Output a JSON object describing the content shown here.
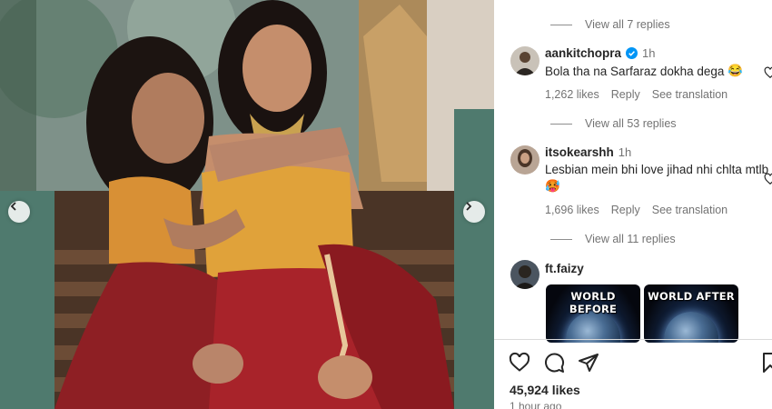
{
  "photo": {
    "alt_subject": "",
    "prev_icon": "chevron-left-icon",
    "next_icon": "chevron-right-icon"
  },
  "replies_top": {
    "label": "View all 7 replies"
  },
  "comments": [
    {
      "user": "aankitchopra",
      "verified": true,
      "time": "1h",
      "text": "Bola tha na Sarfaraz dokha dega",
      "emoji": "😂",
      "likes": "1,262 likes",
      "reply": "Reply",
      "translate": "See translation",
      "replies": "View all 53 replies"
    },
    {
      "user": "itsokearshh",
      "verified": false,
      "time": "1h",
      "text": "Lesbian mein bhi love jihad nhi chlta mtlb",
      "emoji": "🥵",
      "likes": "1,696 likes",
      "reply": "Reply",
      "translate": "See translation",
      "replies": "View all 11 replies"
    },
    {
      "user": "ft.faizy",
      "thumbs": [
        "WORLD BEFORE",
        "WORLD AFTER"
      ]
    }
  ],
  "post": {
    "likes": "45,924 likes",
    "time": "1 hour ago"
  },
  "colors": {
    "accent": "#0095f6",
    "muted": "#737373",
    "text": "#262626"
  }
}
